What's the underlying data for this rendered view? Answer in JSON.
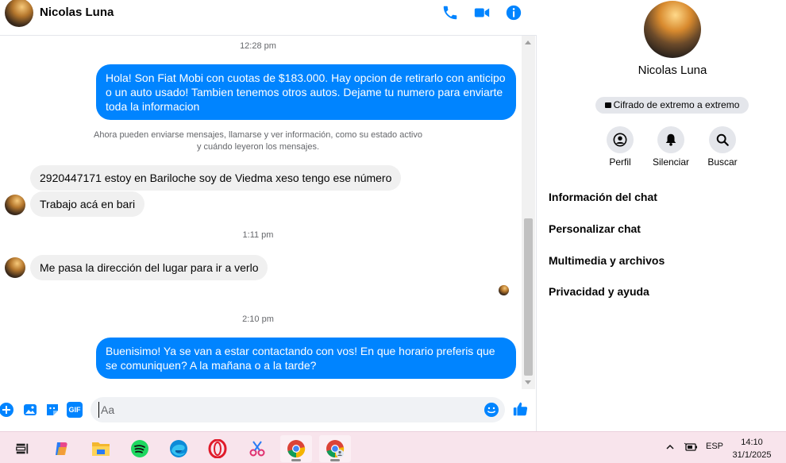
{
  "header": {
    "contact_name": "Nicolas Luna",
    "icons": [
      "phone-icon",
      "video-camera-icon",
      "info-icon"
    ],
    "accent_color": "#0084ff"
  },
  "messages": {
    "ts1": "12:28 pm",
    "out1": "Hola! Son Fiat Mobi con cuotas de $183.000. Hay opcion de retirarlo con anticipo o un auto usado! Tambien tenemos otros autos. Dejame tu numero para enviarte toda la informacion",
    "system_line1": "Ahora pueden enviarse mensajes, llamarse y ver información, como su estado activo",
    "system_line2": "y cuándo leyeron los mensajes.",
    "in1": "2920447171 estoy en Bariloche soy de Viedma xeso tengo ese número",
    "in2": "Trabajo acá en bari",
    "ts2": "1:11 pm",
    "in3": "Me pasa la dirección del lugar para ir a verlo",
    "ts3": "2:10 pm",
    "out2": "Buenisimo! Ya se van a estar contactando con vos! En que horario preferis que se comuniquen? A la mañana o a la tarde?"
  },
  "composer": {
    "placeholder": "Aa",
    "icons": [
      "plus-icon",
      "image-icon",
      "sticker-icon",
      "gif-icon",
      "emoji-icon",
      "thumbs-up-icon"
    ],
    "gif_label": "GIF"
  },
  "info": {
    "name": "Nicolas Luna",
    "encryption": "Cifrado de extremo a extremo",
    "actions": [
      {
        "label": "Perfil"
      },
      {
        "label": "Silenciar"
      },
      {
        "label": "Buscar"
      }
    ],
    "menu": [
      {
        "label": "Información del chat"
      },
      {
        "label": "Personalizar chat"
      },
      {
        "label": "Multimedia y archivos"
      },
      {
        "label": "Privacidad y ayuda"
      }
    ]
  },
  "taskbar": {
    "apps": [
      "task-view-icon",
      "copilot-icon",
      "file-explorer-icon",
      "spotify-icon",
      "edge-icon",
      "opera-icon",
      "snipping-tool-icon",
      "chrome-icon",
      "chrome-profile-icon"
    ],
    "language": "ESP",
    "time": "14:10",
    "date": "31/1/2025"
  }
}
